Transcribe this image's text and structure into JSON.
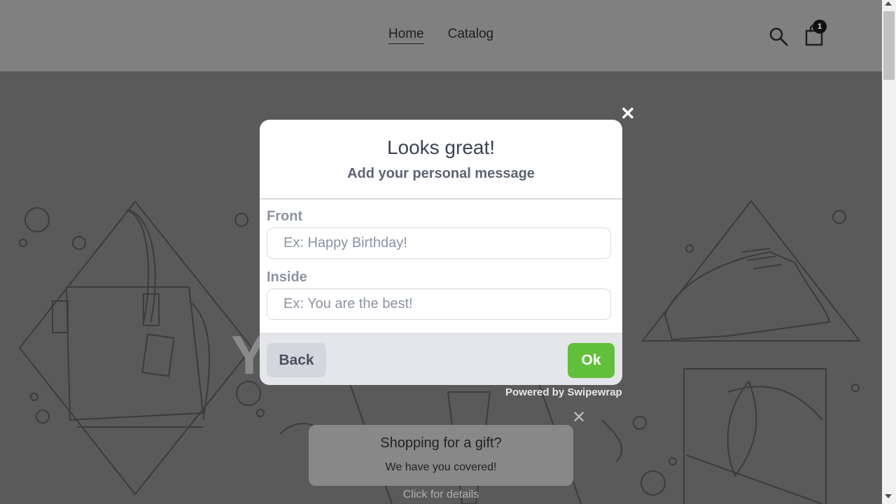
{
  "header": {
    "nav": [
      {
        "label": "Home",
        "active": true
      },
      {
        "label": "Catalog",
        "active": false
      }
    ],
    "cart_count": "1",
    "icons": [
      "search-icon",
      "cart-icon"
    ]
  },
  "hero": {
    "title_visible_text": "Y          nt"
  },
  "modal": {
    "close_symbol": "✕",
    "title": "Looks great!",
    "subtitle": "Add your personal message",
    "front_label": "Front",
    "front_placeholder": "Ex: Happy Birthday!",
    "inside_label": "Inside",
    "inside_placeholder": "Ex: You are the best!",
    "back_label": "Back",
    "ok_label": "Ok",
    "ok_color": "#62bf3b"
  },
  "powered_by": "Powered by Swipewrap",
  "gift_toast": {
    "close_symbol": "✕",
    "title": "Shopping for a gift?",
    "body": "We have you covered!",
    "link": "Click for details"
  }
}
